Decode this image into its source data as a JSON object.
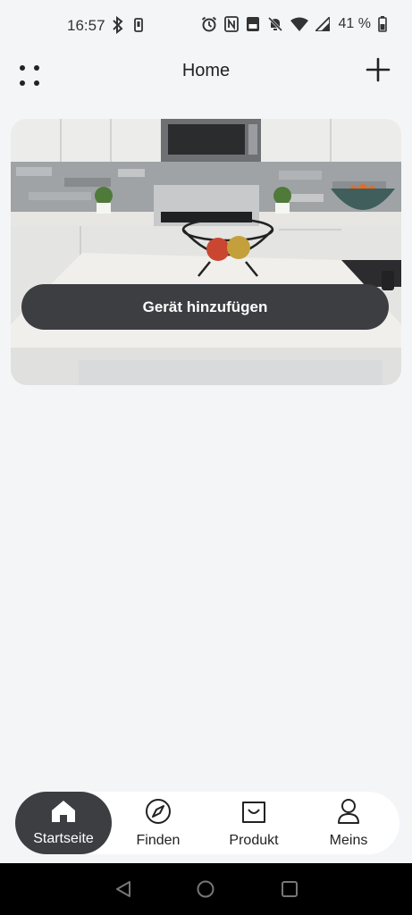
{
  "status_bar": {
    "time": "16:57",
    "battery_text": "41 %",
    "icons_left": [
      "bluetooth-icon",
      "phone-icon"
    ],
    "icons_right": [
      "alarm-icon",
      "nfc-icon",
      "volte-icon",
      "mute-icon",
      "wifi-icon",
      "signal-icon",
      "battery-icon"
    ]
  },
  "app_bar": {
    "title": "Home",
    "menu_icon": "dots-grid-icon",
    "add_icon": "plus-icon"
  },
  "card": {
    "image": "kitchen-image",
    "button_label": "Gerät hinzufügen"
  },
  "bottom_nav": {
    "items": [
      {
        "label": "Startseite",
        "icon": "home-icon",
        "active": true
      },
      {
        "label": "Finden",
        "icon": "compass-icon",
        "active": false
      },
      {
        "label": "Produkt",
        "icon": "shopping-bag-icon",
        "active": false
      },
      {
        "label": "Meins",
        "icon": "user-icon",
        "active": false
      }
    ]
  },
  "system_nav": {
    "buttons": [
      "back-icon",
      "home-circle-icon",
      "recents-icon"
    ]
  },
  "colors": {
    "background": "#f4f5f7",
    "dark_accent": "#3c3e42",
    "nav_background": "#ffffff"
  }
}
